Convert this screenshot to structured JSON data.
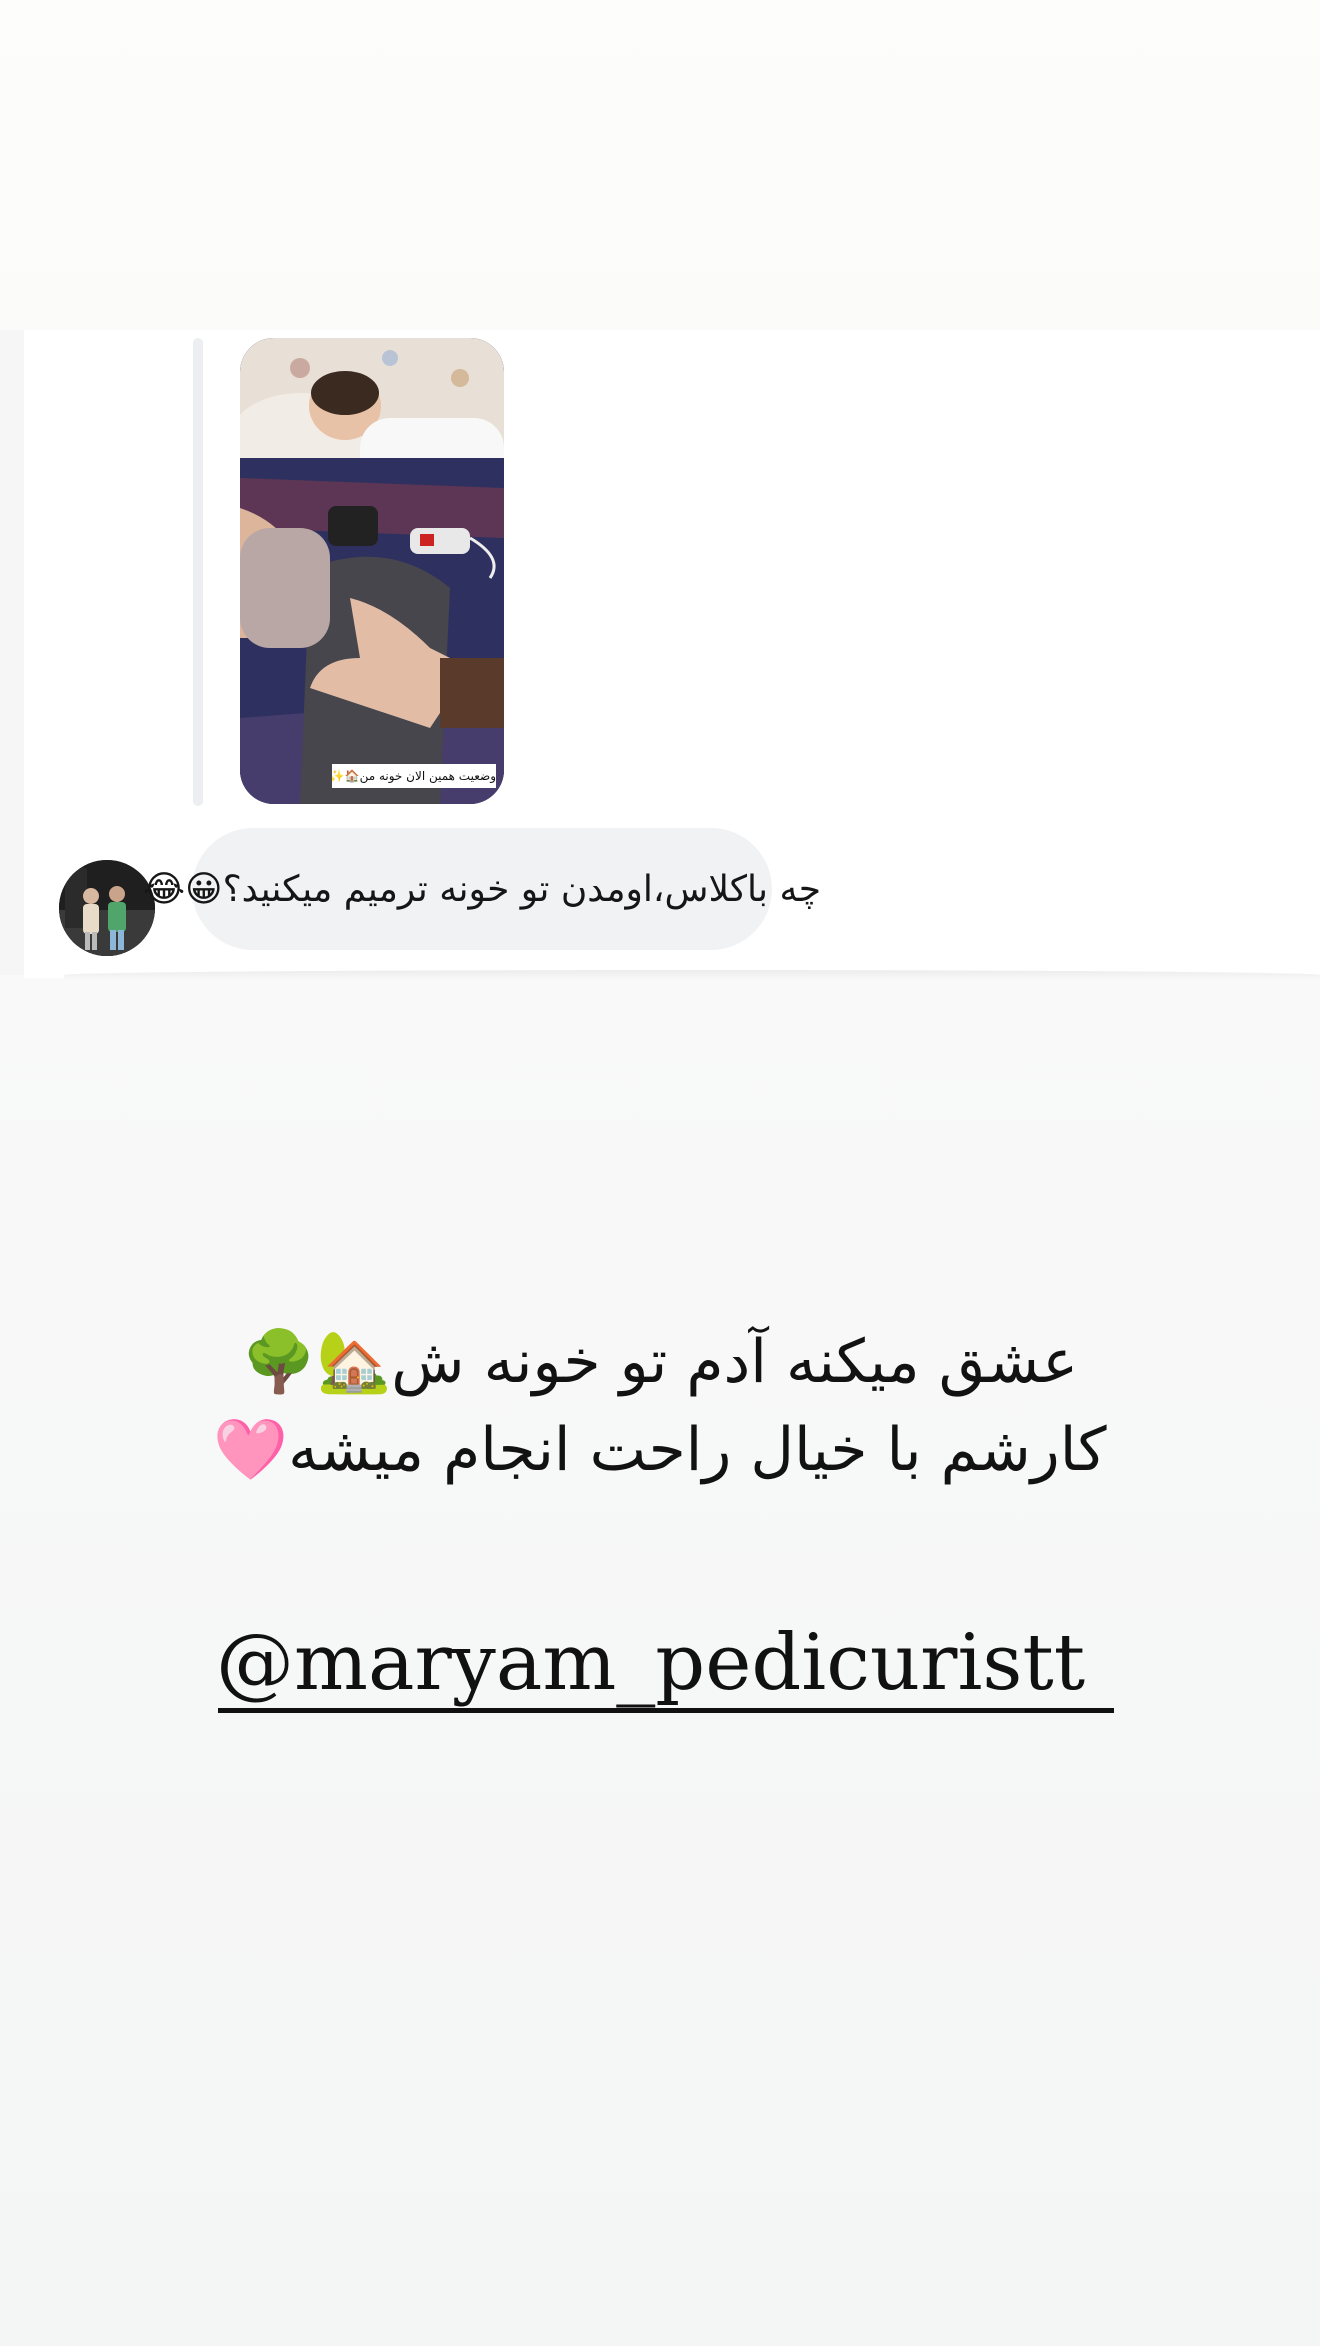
{
  "dm": {
    "story_caption": "وضعیت همین الان خونه من🏠✨",
    "message": "چه باکلاس،اومدن تو خونه ترمیم میکنید؟😀😂"
  },
  "story": {
    "line1": "عشق میکنه آدم تو خونه ش🏡🌳",
    "line2": "کارشم با خیال راحت انجام میشه🩷",
    "mention": "@maryam_pedicuristt"
  }
}
